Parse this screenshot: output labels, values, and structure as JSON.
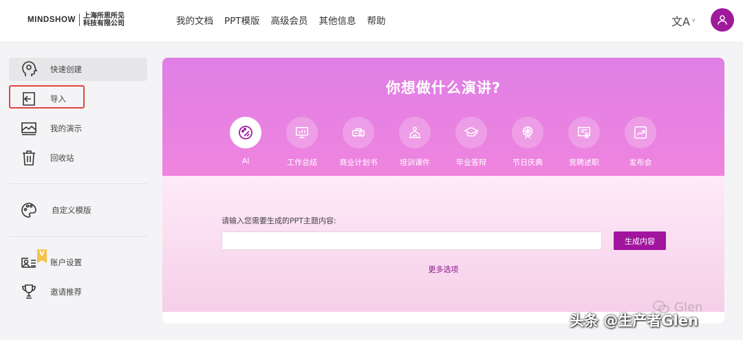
{
  "header": {
    "logo_word": "MINDSHOW",
    "logo_company": "上海所思所见科技有限公司",
    "nav": [
      "我的文档",
      "PPT模版",
      "高级会员",
      "其他信息",
      "帮助"
    ],
    "lang_glyph": "文A"
  },
  "sidebar": {
    "items": [
      {
        "label": "快速创建",
        "icon": "brain-head-icon"
      },
      {
        "label": "导入",
        "icon": "import-icon"
      },
      {
        "label": "我的演示",
        "icon": "presentation-icon"
      },
      {
        "label": "回收站",
        "icon": "trash-icon"
      },
      {
        "label": "自定义模版",
        "icon": "palette-icon"
      },
      {
        "label": "账户设置",
        "icon": "account-card-icon"
      },
      {
        "label": "邀请推荐",
        "icon": "trophy-icon"
      }
    ],
    "vip_badge": "V"
  },
  "main": {
    "title": "你想做什么演讲?",
    "categories": [
      {
        "label": "AI",
        "icon": "ai-palette-icon"
      },
      {
        "label": "工作总结",
        "icon": "monitor-chart-icon"
      },
      {
        "label": "商业计划书",
        "icon": "projector-icon"
      },
      {
        "label": "培训课件",
        "icon": "training-icon"
      },
      {
        "label": "毕业答辩",
        "icon": "graduation-cap-icon"
      },
      {
        "label": "节日庆典",
        "icon": "ferris-wheel-icon"
      },
      {
        "label": "竞聘述职",
        "icon": "certificate-icon"
      },
      {
        "label": "发布会",
        "icon": "trend-chart-icon"
      }
    ],
    "prompt_label": "请输入您需要生成的PPT主题内容:",
    "input_value": "",
    "input_placeholder": "",
    "generate_label": "生成内容",
    "more_label": "更多选项"
  },
  "watermark": {
    "small": "Glen",
    "main": "头条 @生产者Glen"
  },
  "colors": {
    "brand": "#a01a9c",
    "highlight": "#e0453f",
    "hero_top": "#df7fe6",
    "hero_bottom": "#ef84de"
  }
}
